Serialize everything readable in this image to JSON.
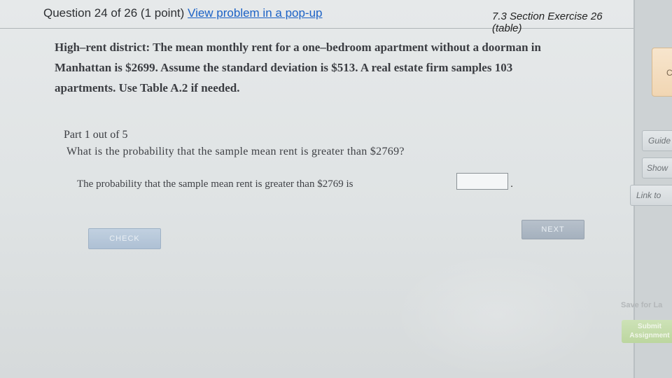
{
  "header": {
    "question_label": "Question 24 of 26 (1 point)",
    "popup_link": "View problem in a pop-up",
    "section_label": "7.3 Section Exercise 26 (table)"
  },
  "problem": {
    "text_line1": "High–rent district: The mean monthly rent for a one–bedroom apartment without a doorman in",
    "text_line2": "Manhattan is $2699. Assume the standard deviation is $513. A real estate firm samples 103",
    "text_line3": "apartments. Use Table A.2 if needed."
  },
  "part": {
    "title": "Part 1 out of 5",
    "question": "What is the probability that the sample mean rent is greater than $2769?",
    "answer_prompt": "The probability that the sample mean rent is greater than $2769 is",
    "answer_value": "",
    "period": "."
  },
  "buttons": {
    "check": "CHECK",
    "next": "NEXT"
  },
  "sidebar": {
    "close_label": "Cl",
    "guide_label": "Guide",
    "show_label": "Show",
    "link_label": "Link to",
    "save_label": "Save for La",
    "submit_label_1": "Submit",
    "submit_label_2": "Assignment"
  }
}
